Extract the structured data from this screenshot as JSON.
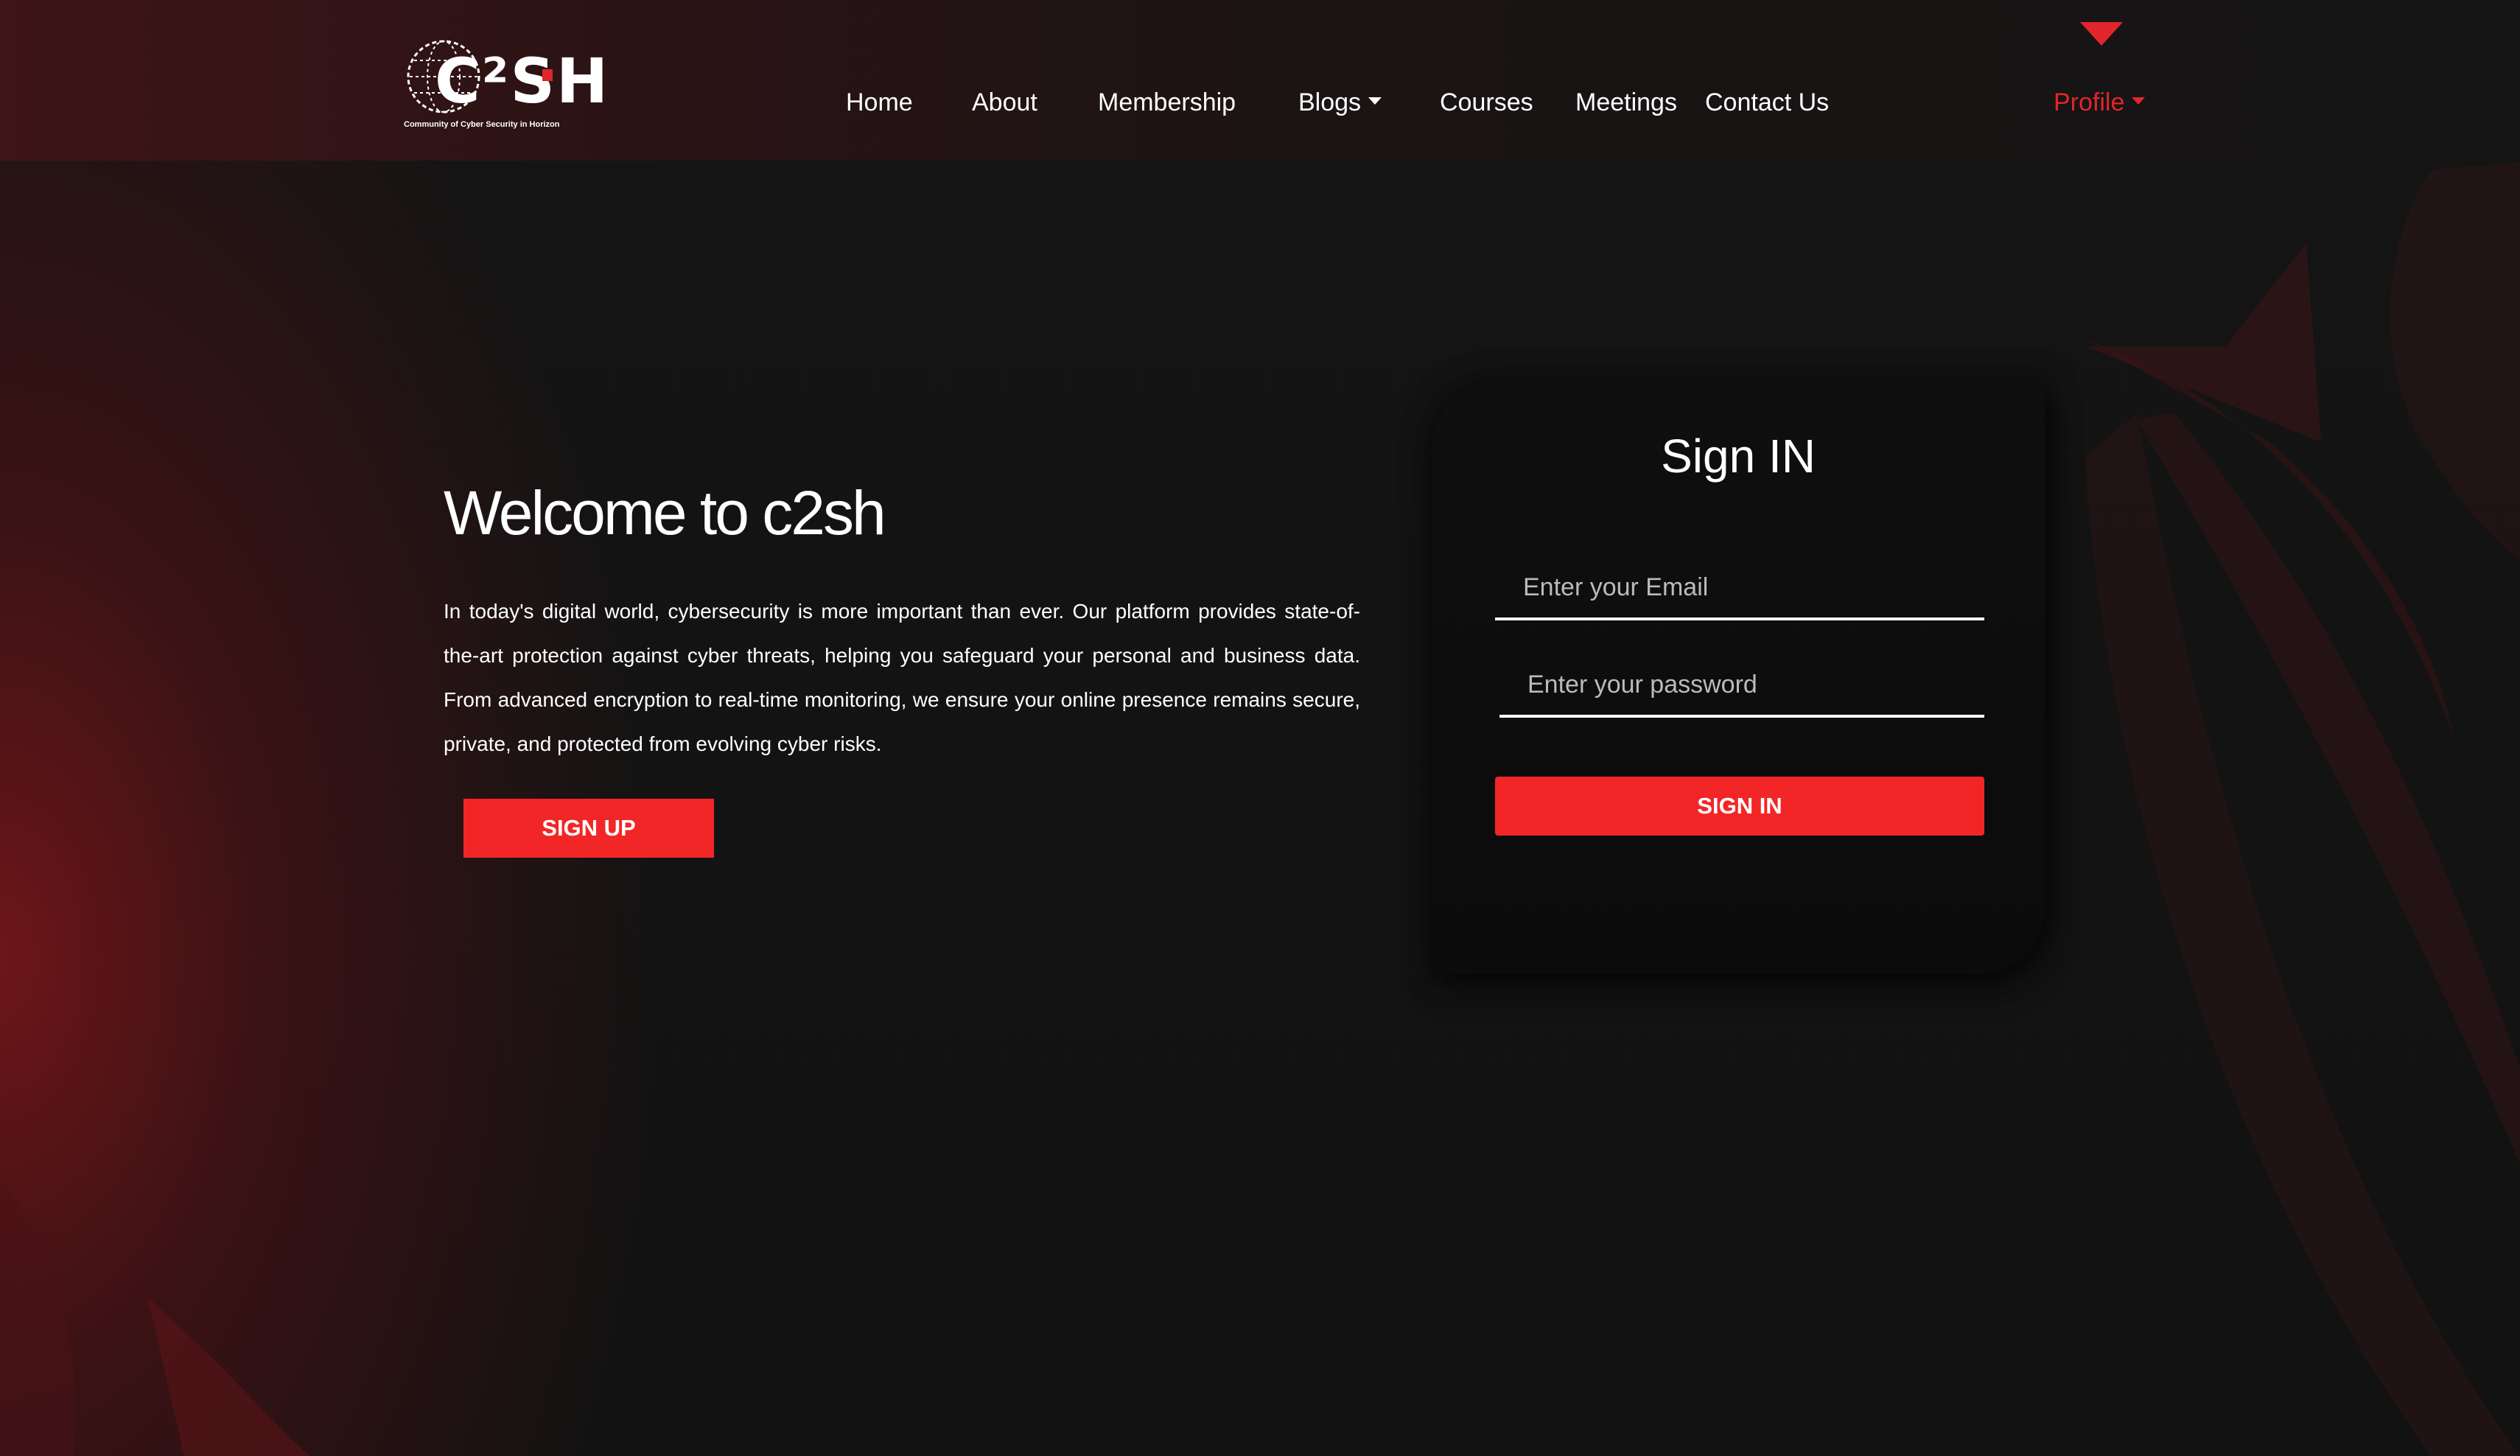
{
  "brand": {
    "logo_text": "C²SH",
    "tagline": "Community of Cyber Security in Horizon"
  },
  "nav": {
    "home": "Home",
    "about": "About",
    "membership": "Membership",
    "blogs": "Blogs",
    "courses": "Courses",
    "meetings": "Meetings",
    "contact": "Contact Us",
    "profile": "Profile"
  },
  "hero": {
    "title": "Welcome to c2sh",
    "text": "In today's digital world, cybersecurity is more important than ever. Our platform provides state-of-the-art protection against cyber threats, helping you safeguard your personal and business data. From advanced encryption to real-time monitoring, we ensure your online presence remains secure, private, and protected from evolving cyber risks.",
    "signup_label": "SIGN UP"
  },
  "signin": {
    "title": "Sign IN",
    "email_placeholder": "Enter your Email",
    "password_placeholder": "Enter your password",
    "button_label": "SIGN IN"
  },
  "colors": {
    "accent": "#f22627",
    "background": "#111111",
    "card": "#0d0d0d"
  },
  "icons": {
    "logo": "globe-logo-icon",
    "dropdown": "caret-down-icon",
    "top_marker": "triangle-down-icon"
  }
}
